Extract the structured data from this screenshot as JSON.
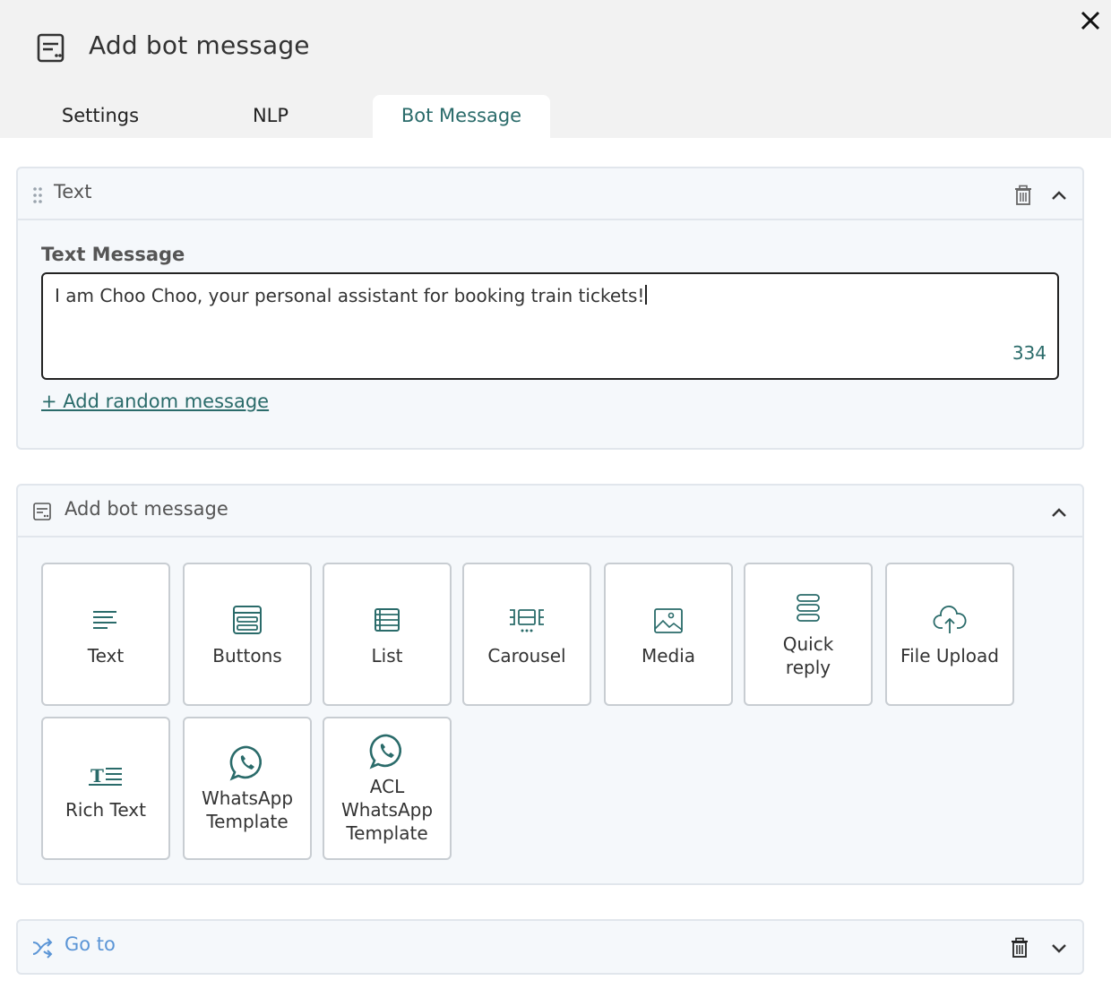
{
  "header": {
    "title": "Add bot message",
    "close_icon": "close-icon"
  },
  "tabs": [
    {
      "label": "Settings",
      "active": false
    },
    {
      "label": "NLP",
      "active": false
    },
    {
      "label": "Bot Message",
      "active": true
    }
  ],
  "text_panel": {
    "title": "Text",
    "field_label": "Text Message",
    "value": "I am Choo Choo, your personal assistant for booking train tickets!",
    "char_count": "334",
    "add_random": "+ Add random message"
  },
  "add_panel": {
    "title": "Add bot message",
    "tiles": [
      {
        "label": "Text",
        "icon": "text-lines-icon"
      },
      {
        "label": "Buttons",
        "icon": "buttons-icon"
      },
      {
        "label": "List",
        "icon": "list-icon"
      },
      {
        "label": "Carousel",
        "icon": "carousel-icon"
      },
      {
        "label": "Media",
        "icon": "image-icon"
      },
      {
        "label": "Quick reply",
        "icon": "quick-reply-icon"
      },
      {
        "label": "File Upload",
        "icon": "cloud-upload-icon"
      },
      {
        "label": "Rich Text",
        "icon": "rich-text-icon"
      },
      {
        "label": "WhatsApp Template",
        "icon": "whatsapp-icon"
      },
      {
        "label": "ACL WhatsApp Template",
        "icon": "whatsapp-icon"
      }
    ]
  },
  "goto_panel": {
    "title": "Go to"
  },
  "colors": {
    "accent": "#2a6b6a",
    "link_blue": "#5b95d6",
    "panel_bg": "#f5f8fb",
    "border": "#e1e6ec"
  }
}
